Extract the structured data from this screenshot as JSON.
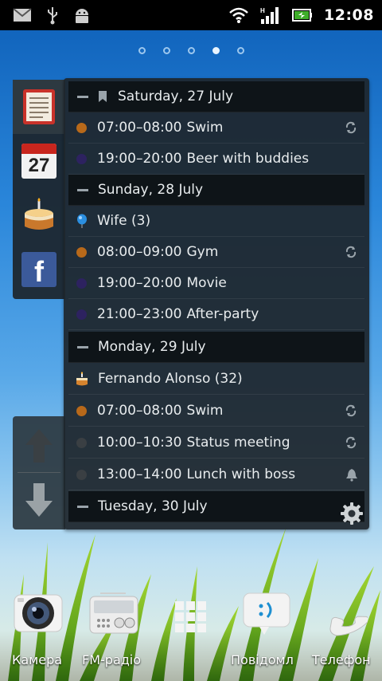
{
  "status_bar": {
    "time": "12:08",
    "icons": [
      "gmail-icon",
      "usb-icon",
      "android-debug-icon",
      "wifi-icon",
      "signal-icon",
      "battery-icon"
    ]
  },
  "home_pages": {
    "count": 5,
    "active_index": 3
  },
  "widget": {
    "tabs": [
      "agenda-tab-icon",
      "calendar-tab-icon",
      "birthday-tab-icon",
      "facebook-tab-icon"
    ],
    "calendar_tab_day": "27",
    "agenda": [
      {
        "type": "day",
        "label": "Saturday, 27 July",
        "bookmark": true
      },
      {
        "type": "event",
        "time": "07:00–08:00",
        "title": "Swim",
        "color": "#b8691a",
        "repeat": true
      },
      {
        "type": "event",
        "time": "19:00–20:00",
        "title": "Beer with buddies",
        "color": "#2d2260"
      },
      {
        "type": "day",
        "label": "Sunday, 28 July"
      },
      {
        "type": "special",
        "text": "Wife (3)",
        "icon": "balloon-icon"
      },
      {
        "type": "event",
        "time": "08:00–09:00",
        "title": "Gym",
        "color": "#b8691a",
        "repeat": true
      },
      {
        "type": "event",
        "time": "19:00–20:00",
        "title": "Movie",
        "color": "#2d2260"
      },
      {
        "type": "event",
        "time": "21:00–23:00",
        "title": "After-party",
        "color": "#2d2260"
      },
      {
        "type": "day",
        "label": "Monday, 29 July"
      },
      {
        "type": "special",
        "text": "Fernando Alonso (32)",
        "icon": "cake-icon"
      },
      {
        "type": "event",
        "time": "07:00–08:00",
        "title": "Swim",
        "color": "#b8691a",
        "repeat": true
      },
      {
        "type": "event",
        "time": "10:00–10:30",
        "title": "Status meeting",
        "color": "#3a3f43",
        "repeat": true
      },
      {
        "type": "event",
        "time": "13:00–14:00",
        "title": "Lunch with boss",
        "color": "#3a3f43",
        "alarm": true
      },
      {
        "type": "day",
        "label": "Tuesday, 30 July"
      }
    ]
  },
  "dock": {
    "camera": "Камера",
    "fm_radio": "FM-радіо",
    "messages": "Повідомл",
    "phone": "Телефон"
  },
  "colors": {
    "accent_orange": "#b8691a",
    "accent_purple": "#2d2260"
  }
}
